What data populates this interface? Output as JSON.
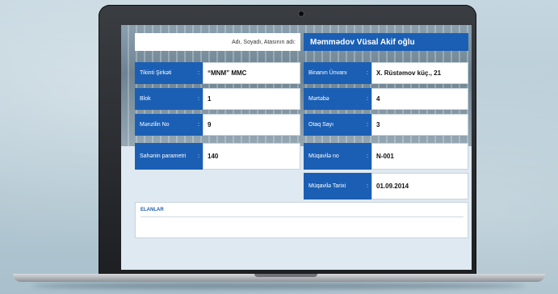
{
  "form": {
    "name_label": "Adı, Soyadı, Atasının adı:",
    "name_value": "Məmmədov Vüsal Akif oğlu",
    "left_rows": [
      {
        "label": "Tikinti Şirkəti",
        "value": "“MNM” MMC"
      },
      {
        "label": "Blok",
        "value": "1"
      },
      {
        "label": "Mənzilin No",
        "value": "9"
      },
      {
        "label": "Sahənin parametri",
        "value": "140"
      }
    ],
    "right_rows": [
      {
        "label": "Binanın Ünvanı",
        "value": "X. Rüstəmov küç., 21"
      },
      {
        "label": "Mərtəbə",
        "value": "4"
      },
      {
        "label": "Otaq Sayı",
        "value": "3"
      },
      {
        "label": "Müqavilə no",
        "value": "N-001"
      },
      {
        "label": "Müqavilə Tarixi",
        "value": "01.09.2014"
      }
    ],
    "colon": ":",
    "news_title": "ELANLAR"
  },
  "colors": {
    "accent": "#1a5fb4",
    "field_bg": "#ffffff",
    "screen_bg": "#dfe9f1",
    "laptop_frame": "#2a2c30"
  }
}
